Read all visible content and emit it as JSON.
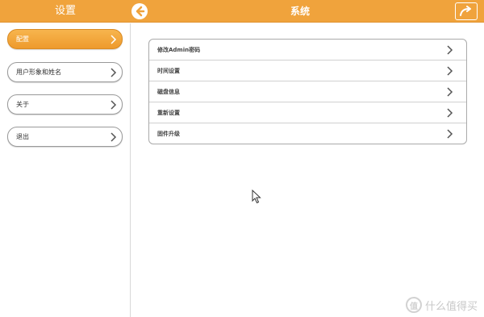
{
  "header": {
    "left_title": "设置",
    "center_title": "系统",
    "back_icon": "back-arrow-icon",
    "share_icon": "share-icon",
    "color": "#f0a33c"
  },
  "sidebar": {
    "items": [
      {
        "label": "配置",
        "active": true
      },
      {
        "label": "用户形象和姓名",
        "active": false
      },
      {
        "label": "关于",
        "active": false
      },
      {
        "label": "退出",
        "active": false
      }
    ]
  },
  "settings": {
    "items": [
      {
        "label": "修改Admin密码"
      },
      {
        "label": "时间设置"
      },
      {
        "label": "磁盘信息"
      },
      {
        "label": "重新设置"
      },
      {
        "label": "固件升级"
      }
    ]
  },
  "watermark": {
    "badge": "值",
    "text": "什么值得买"
  }
}
